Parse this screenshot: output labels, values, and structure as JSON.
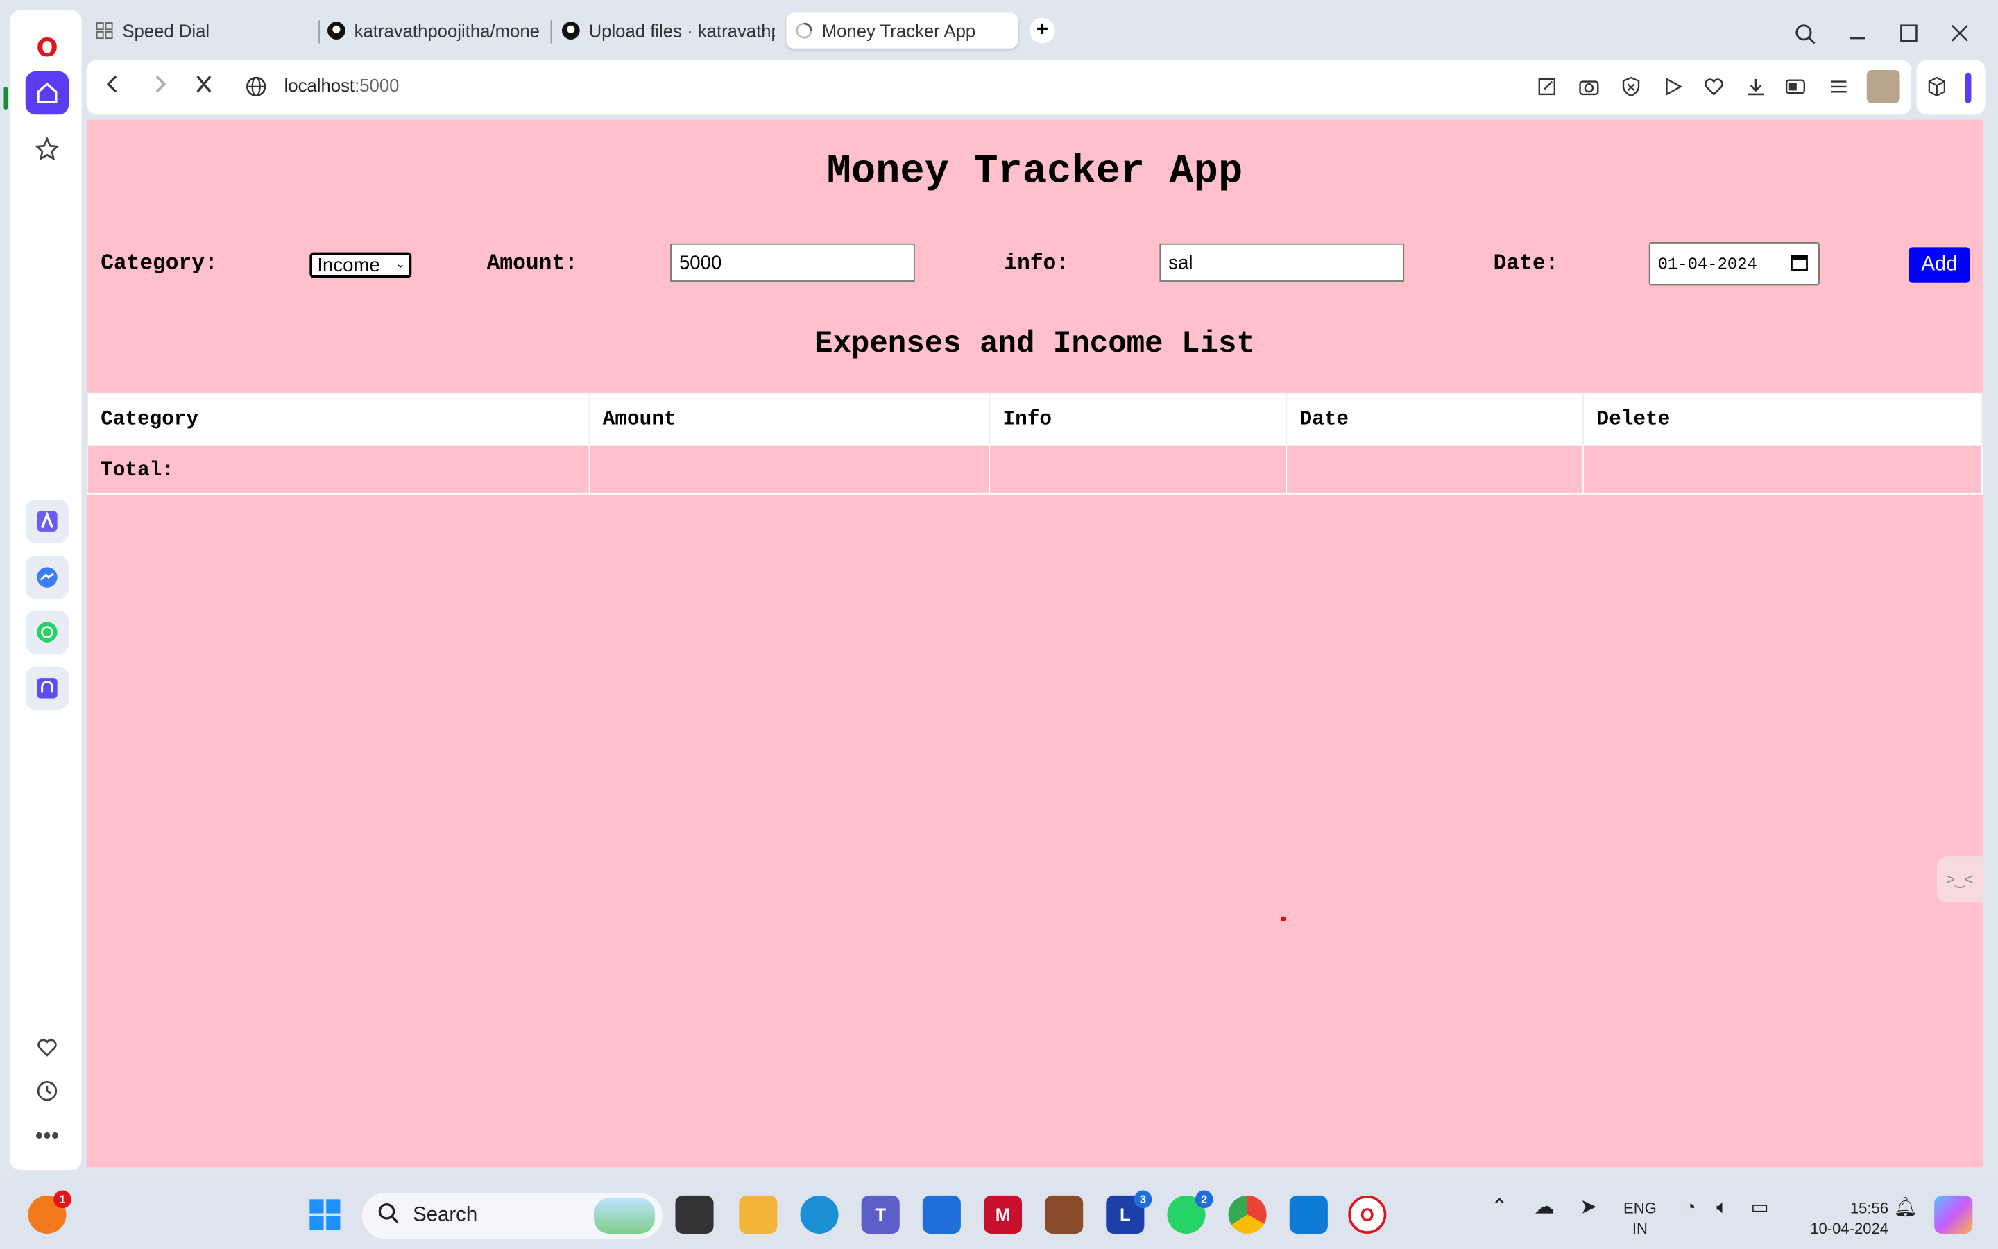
{
  "browser": {
    "tabs": [
      {
        "title": "Speed Dial",
        "icon": "grid-icon"
      },
      {
        "title": "katravathpoojitha/money-",
        "icon": "github-icon"
      },
      {
        "title": "Upload files · katravathpoo",
        "icon": "github-icon"
      },
      {
        "title": "Money Tracker App",
        "icon": "loading-icon",
        "active": true
      }
    ],
    "url_host": "localhost",
    "url_port": ":5000"
  },
  "app": {
    "title": "Money Tracker App",
    "category_label": "Category:",
    "category_value": "Income",
    "amount_label": "Amount:",
    "amount_value": "5000",
    "info_label": "info:",
    "info_value": "sal",
    "date_label": "Date:",
    "date_value": "01-04-2024",
    "add_label": "Add",
    "list_title": "Expenses and Income List",
    "table_headers": [
      "Category",
      "Amount",
      "Info",
      "Date",
      "Delete"
    ],
    "total_label": "Total:"
  },
  "taskbar": {
    "search_placeholder": "Search",
    "lang_top": "ENG",
    "lang_bottom": "IN",
    "time": "15:56",
    "date": "10-04-2024",
    "badges": {
      "notify": "1",
      "teams_l": "3",
      "whatsapp": "2"
    }
  }
}
